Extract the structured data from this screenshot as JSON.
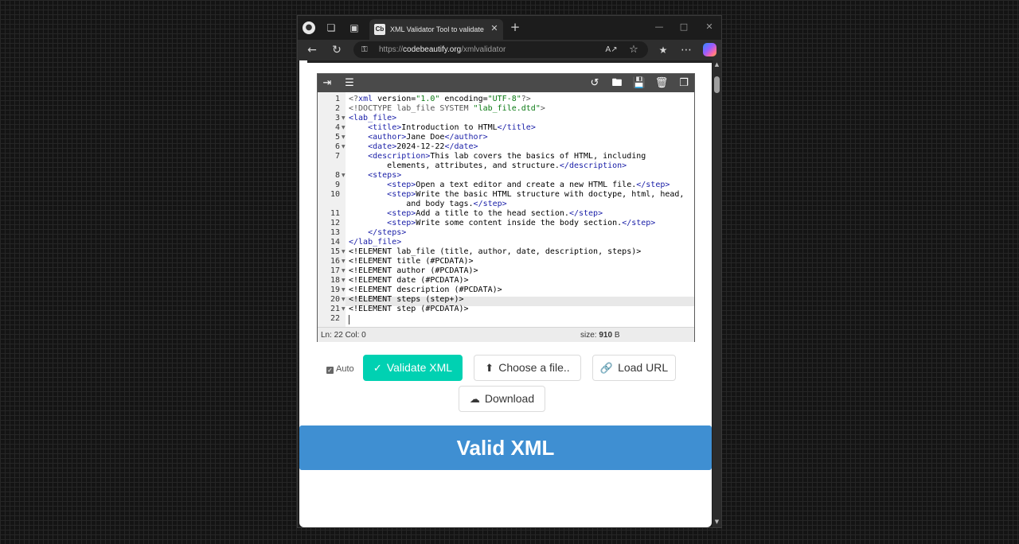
{
  "browser": {
    "tab_favicon": "Cb",
    "tab_title": "XML Validator Tool to validate XML",
    "tab_close": "✕",
    "new_tab": "+",
    "address": {
      "scheme": "https://",
      "host": "codebeautify.org",
      "path": "/xmlvalidator"
    },
    "icons": [
      "profile-icon",
      "workspaces-icon",
      "tab-actions-icon",
      "back-icon",
      "refresh-icon",
      "lock-icon",
      "read-aloud-icon",
      "favorite-icon",
      "favorites-icon",
      "menu-icon",
      "copilot-icon"
    ]
  },
  "editor": {
    "toolbar_icons": [
      "indent-icon",
      "format-icon",
      "history-icon",
      "open-folder-icon",
      "save-icon",
      "delete-icon",
      "copy-icon"
    ],
    "line_numbers": [
      "1",
      "2",
      "3",
      "4",
      "5",
      "6",
      "7",
      "8",
      "9",
      "10",
      "11",
      "12",
      "13",
      "14",
      "15",
      "16",
      "17",
      "18",
      "19",
      "20",
      "21",
      "22"
    ],
    "status": {
      "position": "Ln: 22 Col: 0",
      "size_label": "size:",
      "size_value": "910",
      "size_unit": "B"
    }
  },
  "controls": {
    "auto_label": "Auto",
    "validate_label": "Validate XML",
    "choose_label": "Choose a file..",
    "load_url_label": "Load URL",
    "download_label": "Download"
  },
  "result": {
    "message": "Valid XML"
  },
  "colors": {
    "validate": "#00d1b2",
    "result": "#3f8fd2",
    "tag": "#1b20a8",
    "string": "#0a7a13"
  }
}
